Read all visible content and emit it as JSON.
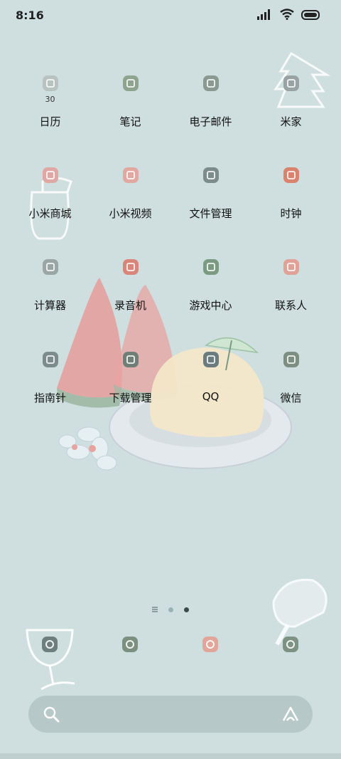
{
  "status_bar": {
    "time": "8:16",
    "icons": [
      "signal-icon",
      "wifi-icon",
      "battery-icon"
    ]
  },
  "apps": [
    {
      "label": "日历",
      "sub": "30",
      "icon": "calendar-icon",
      "color": "#b8c3bf"
    },
    {
      "label": "笔记",
      "icon": "notes-icon",
      "color": "#8ea48f"
    },
    {
      "label": "电子邮件",
      "icon": "email-icon",
      "color": "#8a9a92"
    },
    {
      "label": "米家",
      "icon": "mi-home-icon",
      "color": "#9aa3a3"
    },
    {
      "label": "小米商城",
      "icon": "mi-store-icon",
      "color": "#e0a8a4"
    },
    {
      "label": "小米视频",
      "icon": "video-icon",
      "color": "#e3a7a2"
    },
    {
      "label": "文件管理",
      "icon": "file-manager-icon",
      "color": "#7b8c8a"
    },
    {
      "label": "时钟",
      "icon": "clock-icon",
      "color": "#d9826e"
    },
    {
      "label": "计算器",
      "icon": "calculator-icon",
      "color": "#9aa6a3"
    },
    {
      "label": "录音机",
      "icon": "recorder-icon",
      "color": "#d9857a"
    },
    {
      "label": "游戏中心",
      "icon": "game-center-icon",
      "color": "#7a9a82"
    },
    {
      "label": "联系人",
      "icon": "contacts-icon",
      "color": "#e0a296"
    },
    {
      "label": "指南针",
      "icon": "compass-icon",
      "color": "#7c8b8c"
    },
    {
      "label": "下载管理",
      "icon": "download-icon",
      "color": "#6f7f78"
    },
    {
      "label": "QQ",
      "icon": "qq-icon",
      "color": "#6a7c7e"
    },
    {
      "label": "微信",
      "icon": "wechat-icon",
      "color": "#7d8f82"
    }
  ],
  "page_indicator": {
    "pages": 3,
    "active": 3
  },
  "dock": [
    {
      "icon": "phone-icon",
      "color": "#6d7f7d"
    },
    {
      "icon": "browser-icon",
      "color": "#7c907f"
    },
    {
      "icon": "messages-icon",
      "color": "#e2a59a"
    },
    {
      "icon": "camera-icon",
      "color": "#7d9283"
    }
  ],
  "search": {
    "icon": "search-icon",
    "assistant_icon": "assistant-icon"
  }
}
